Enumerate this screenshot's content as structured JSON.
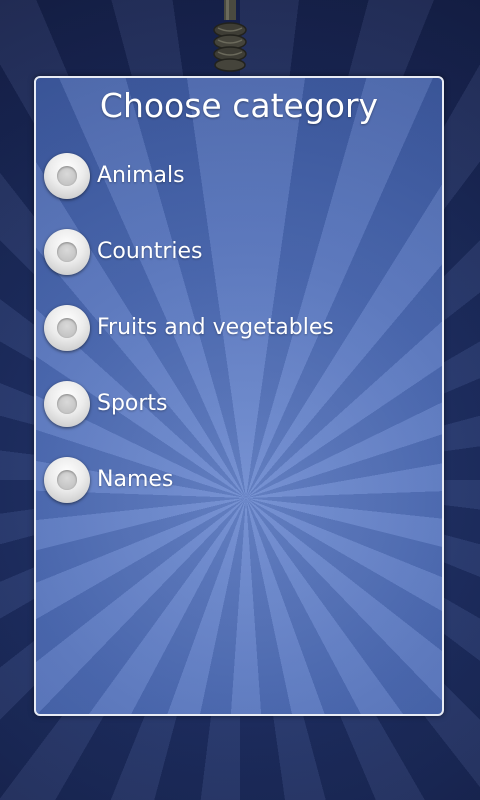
{
  "dialog": {
    "title": "Choose category",
    "options": [
      {
        "label": "Animals",
        "selected": false
      },
      {
        "label": "Countries",
        "selected": false
      },
      {
        "label": "Fruits and vegetables",
        "selected": false
      },
      {
        "label": "Sports",
        "selected": false
      },
      {
        "label": "Names",
        "selected": false
      }
    ]
  },
  "icons": {
    "decoration": "rope-icon",
    "option_control": "radio-button-icon"
  },
  "colors": {
    "background": "#1b2a55",
    "panel": "#4e6fb8",
    "panel_border": "#e8ecf5",
    "text": "#ffffff"
  }
}
